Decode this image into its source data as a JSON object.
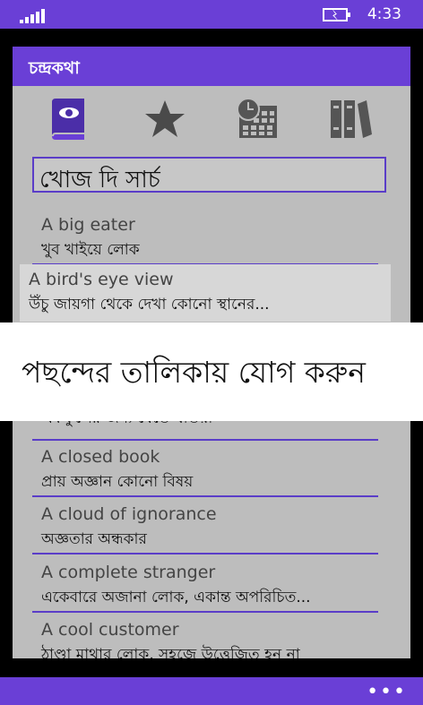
{
  "status": {
    "time": "4:33"
  },
  "app": {
    "title": "চন্দ্রকথা"
  },
  "icons": [
    "book-icon",
    "star-icon",
    "calendar-clock-icon",
    "library-icon"
  ],
  "search": {
    "value": "খোজ দি সার্চ"
  },
  "list": [
    {
      "en": "A big eater",
      "bn": "খুব খাইয়ে লোক"
    },
    {
      "en": "A bird's eye view",
      "bn": "উঁচু জায়গা থেকে দেখা কোনো স্থানের..."
    },
    {
      "en": "",
      "bn": "একফুলের জন্য যেতে যাতয়া"
    },
    {
      "en": "A closed book",
      "bn": "প্রায় অজ্ঞান কোনো বিষয়"
    },
    {
      "en": "A cloud of ignorance",
      "bn": "অজ্ঞতার অন্ধকার"
    },
    {
      "en": "A complete stranger",
      "bn": "একেবারে অজানা লোক, একান্ত অপরিচিত..."
    },
    {
      "en": "A cool customer",
      "bn": "ঠাণ্ডা মাথার লোক, সহজে উত্তেজিত হন না"
    }
  ],
  "popup": {
    "label": "পছন্দের তালিকায় যোগ করুন"
  },
  "appbar": {
    "more": "•••"
  },
  "colors": {
    "accent": "#6A3FD6",
    "panel": "#BDBDBD",
    "divider": "#5A3DC8"
  }
}
